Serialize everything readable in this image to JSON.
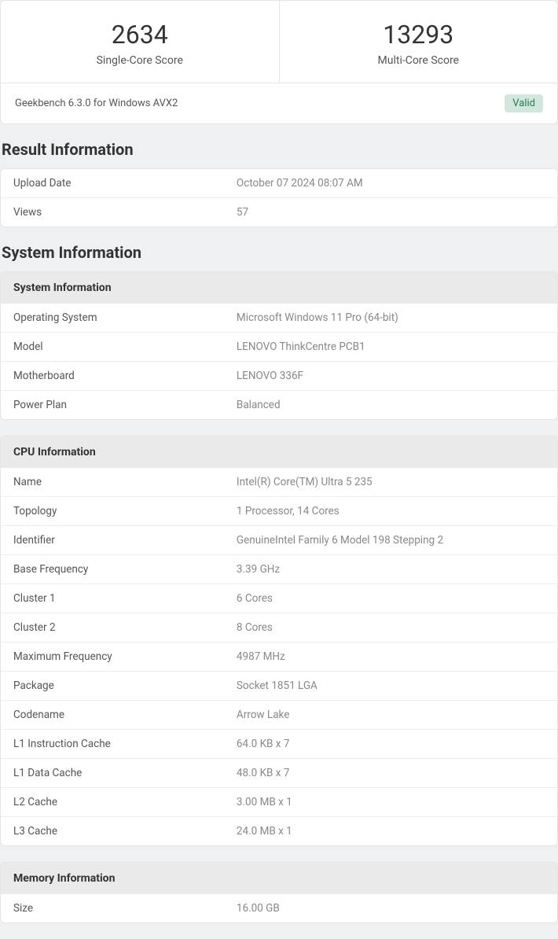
{
  "scores": {
    "single_core": "2634",
    "single_core_label": "Single-Core Score",
    "multi_core": "13293",
    "multi_core_label": "Multi-Core Score"
  },
  "version": {
    "text": "Geekbench 6.3.0 for Windows AVX2",
    "status": "Valid"
  },
  "result_info": {
    "title": "Result Information",
    "rows": [
      {
        "key": "Upload Date",
        "value": "October 07 2024 08:07 AM"
      },
      {
        "key": "Views",
        "value": "57"
      }
    ]
  },
  "system_info_section": {
    "title": "System Information"
  },
  "system_info": {
    "header": "System Information",
    "rows": [
      {
        "key": "Operating System",
        "value": "Microsoft Windows 11 Pro (64-bit)"
      },
      {
        "key": "Model",
        "value": "LENOVO ThinkCentre PCB1"
      },
      {
        "key": "Motherboard",
        "value": "LENOVO 336F"
      },
      {
        "key": "Power Plan",
        "value": "Balanced"
      }
    ]
  },
  "cpu_info": {
    "header": "CPU Information",
    "rows": [
      {
        "key": "Name",
        "value": "Intel(R) Core(TM) Ultra 5 235"
      },
      {
        "key": "Topology",
        "value": "1 Processor, 14 Cores"
      },
      {
        "key": "Identifier",
        "value": "GenuineIntel Family 6 Model 198 Stepping 2"
      },
      {
        "key": "Base Frequency",
        "value": "3.39 GHz"
      },
      {
        "key": "Cluster 1",
        "value": "6 Cores"
      },
      {
        "key": "Cluster 2",
        "value": "8 Cores"
      },
      {
        "key": "Maximum Frequency",
        "value": "4987 MHz"
      },
      {
        "key": "Package",
        "value": "Socket 1851 LGA"
      },
      {
        "key": "Codename",
        "value": "Arrow Lake"
      },
      {
        "key": "L1 Instruction Cache",
        "value": "64.0 KB x 7"
      },
      {
        "key": "L1 Data Cache",
        "value": "48.0 KB x 7"
      },
      {
        "key": "L2 Cache",
        "value": "3.00 MB x 1"
      },
      {
        "key": "L3 Cache",
        "value": "24.0 MB x 1"
      }
    ]
  },
  "memory_info": {
    "header": "Memory Information",
    "rows": [
      {
        "key": "Size",
        "value": "16.00 GB"
      }
    ]
  }
}
